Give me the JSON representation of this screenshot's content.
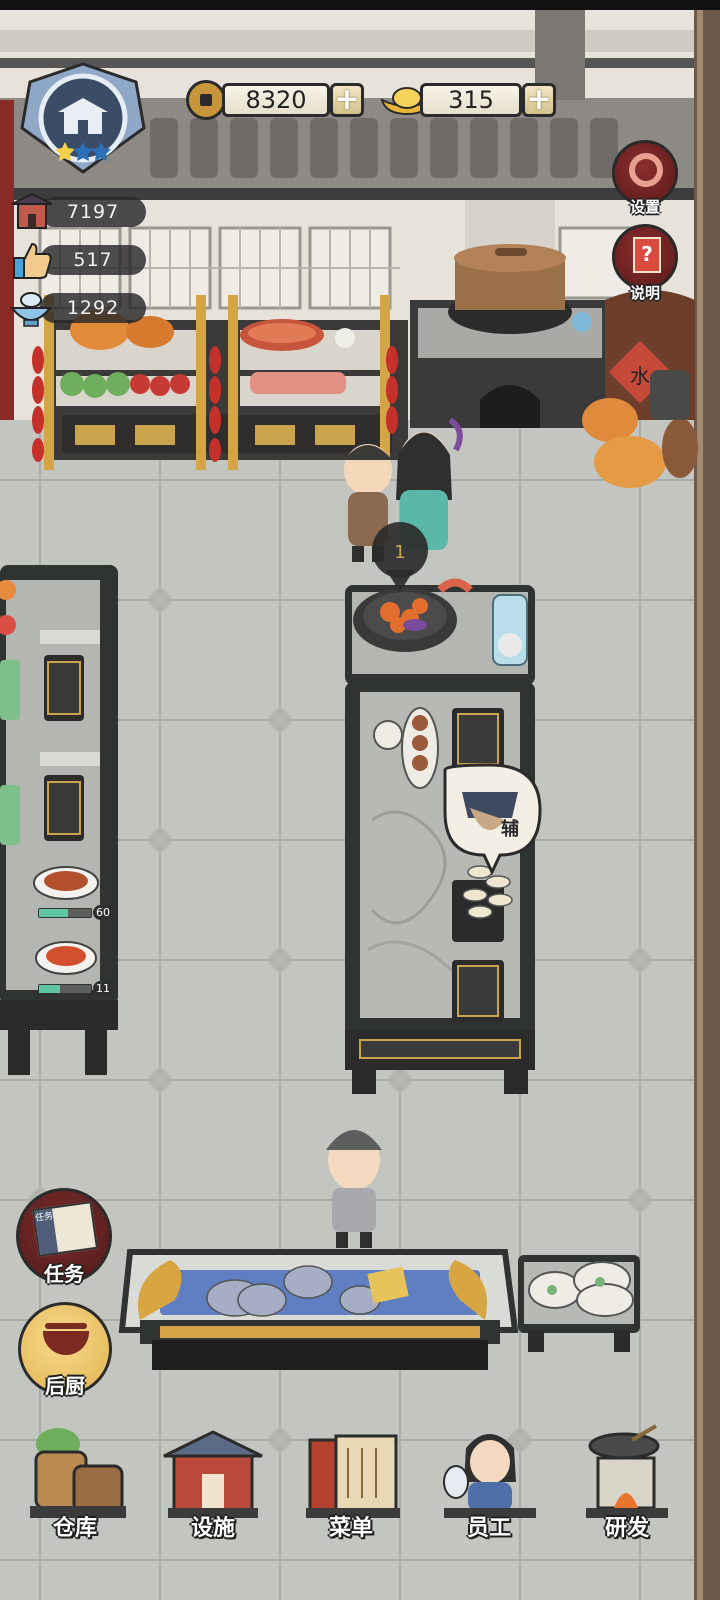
{
  "resources": {
    "coins": {
      "value": "8320",
      "icon": "copper-coin-icon",
      "add": "+"
    },
    "gold": {
      "value": "315",
      "icon": "gold-ingot-icon",
      "add": "+"
    }
  },
  "stats": [
    {
      "icon": "restaurant-icon",
      "value": "7197"
    },
    {
      "icon": "thumbs-up-icon",
      "value": "517"
    },
    {
      "icon": "bowl-icon",
      "value": "1292"
    }
  ],
  "restaurant_rank": {
    "icon": "restaurant-building-icon",
    "stars_filled": 1,
    "stars_total": 3
  },
  "top_right": {
    "settings_label": "设置",
    "help_label": "说明",
    "help_icon_glyph": "?"
  },
  "scene": {
    "water_jar_text": "水",
    "cooking_progress_marker": "1",
    "assistant_bubble_text": "辅",
    "prep_progress": [
      {
        "value": "60",
        "fraction": 0.55
      },
      {
        "value": "11",
        "fraction": 0.4
      }
    ]
  },
  "side_buttons": {
    "tasks_label": "任务",
    "tasks_book_text": "任务",
    "kitchen_label": "后厨"
  },
  "bottom_nav": [
    {
      "label": "仓库",
      "icon": "warehouse-icon"
    },
    {
      "label": "设施",
      "icon": "facility-icon"
    },
    {
      "label": "菜单",
      "icon": "menu-scroll-icon"
    },
    {
      "label": "员工",
      "icon": "staff-icon"
    },
    {
      "label": "研发",
      "icon": "research-stove-icon"
    }
  ],
  "colors": {
    "floor": "#bfc1bd",
    "wall": "#e5e2dc",
    "counter_top": "#b5b7b2",
    "counter_frame": "#2f3331",
    "gold_trim": "#d6a740",
    "accent_red": "#7d2b26"
  }
}
